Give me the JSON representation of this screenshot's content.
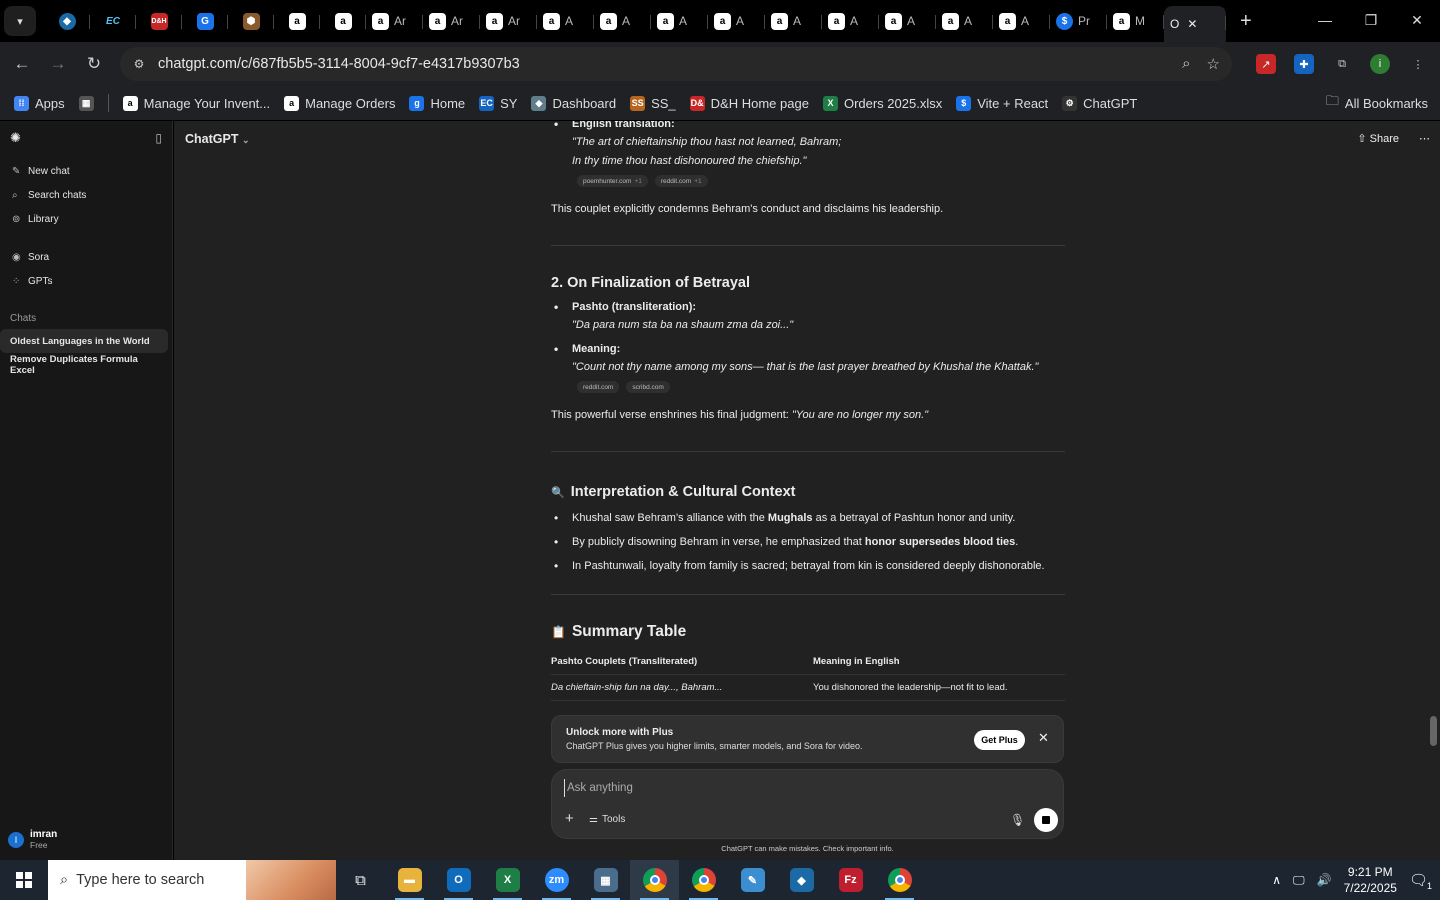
{
  "browser": {
    "tabs": [
      {
        "icon": "chevron-down-icon",
        "label": ""
      },
      {
        "icon": "ecstasy-icon",
        "label": ""
      },
      {
        "icon": "ec-icon",
        "label": "EC"
      },
      {
        "icon": "dh-icon",
        "label": "D&H"
      },
      {
        "icon": "g-icon",
        "label": ""
      },
      {
        "icon": "shield-icon",
        "label": ""
      },
      {
        "icon": "amazon-icon",
        "label": "a"
      },
      {
        "icon": "amazon-icon",
        "label": "a"
      }
    ],
    "wide_tabs": [
      {
        "icon": "a",
        "label": "Ar"
      },
      {
        "icon": "a",
        "label": "Ar"
      },
      {
        "icon": "a",
        "label": "Ar"
      },
      {
        "icon": "a",
        "label": "A"
      },
      {
        "icon": "a",
        "label": "A"
      },
      {
        "icon": "a",
        "label": "A"
      },
      {
        "icon": "a",
        "label": "A"
      },
      {
        "icon": "a",
        "label": "A"
      },
      {
        "icon": "a",
        "label": "A"
      },
      {
        "icon": "a",
        "label": "A"
      },
      {
        "icon": "a",
        "label": "A"
      },
      {
        "icon": "a",
        "label": "A"
      },
      {
        "icon": "$",
        "label": "Pr"
      },
      {
        "icon": "a",
        "label": "M"
      }
    ],
    "active_tab_label": "O",
    "url": "chatgpt.com/c/687fb5b5-3114-8004-9cf7-e4317b9307b3",
    "bookmarks": [
      {
        "icon": "apps",
        "label": "Apps",
        "color": "#4285f4"
      },
      {
        "icon": "grid",
        "label": "",
        "color": "#555"
      },
      {
        "icon": "a",
        "label": "Manage Your Invent...",
        "color": "#000"
      },
      {
        "icon": "a",
        "label": "Manage Orders",
        "color": "#000"
      },
      {
        "icon": "g",
        "label": "Home",
        "color": "#1a73e8"
      },
      {
        "icon": "EC",
        "label": "SY",
        "color": "#1565c0"
      },
      {
        "icon": "◆",
        "label": "Dashboard",
        "color": "#607d8b"
      },
      {
        "icon": "SS",
        "label": "SS_",
        "color": "#b5651d"
      },
      {
        "icon": "D&H",
        "label": "D&H Home page",
        "color": "#c62828"
      },
      {
        "icon": "X",
        "label": "Orders 2025.xlsx",
        "color": "#1e7e45"
      },
      {
        "icon": "$",
        "label": "Vite + React",
        "color": "#1a73e8"
      },
      {
        "icon": "⚙",
        "label": "ChatGPT",
        "color": "#333"
      }
    ],
    "all_bookmarks": "All Bookmarks"
  },
  "sidebar": {
    "items": [
      {
        "icon": "edit-icon",
        "label": "New chat"
      },
      {
        "icon": "search-icon",
        "label": "Search chats"
      },
      {
        "icon": "library-icon",
        "label": "Library"
      }
    ],
    "items2": [
      {
        "icon": "sora-icon",
        "label": "Sora"
      },
      {
        "icon": "gpts-icon",
        "label": "GPTs"
      }
    ],
    "chats_heading": "Chats",
    "chats": [
      "Oldest Languages in the World",
      "Remove Duplicates Formula Excel"
    ],
    "user": {
      "initial": "I",
      "name": "imran",
      "plan": "Free"
    }
  },
  "header": {
    "model": "ChatGPT",
    "share": "Share"
  },
  "content": {
    "english_translation_label": "English translation:",
    "translation_line1": "\"The art of chieftainship thou hast not learned, Bahram;",
    "translation_line2": "In thy time thou hast dishonoured the chiefship.\"",
    "chips1": [
      {
        "label": "poemhunter.com",
        "n": "+1"
      },
      {
        "label": "reddit.com",
        "n": "+1"
      }
    ],
    "para1": "This couplet explicitly condemns Behram's conduct and disclaims his leadership.",
    "h2_betrayal": "2. On Finalization of Betrayal",
    "pashto_label": "Pashto (transliteration):",
    "pashto_line": "\"Da para num sta ba na shaum zma da zoi...\"",
    "meaning_label": "Meaning:",
    "meaning_line": "\"Count not thy name among my sons— that is the last prayer breathed by Khushal the Khattak.\"",
    "chips2": [
      {
        "label": "reddit.com",
        "n": ""
      },
      {
        "label": "scribd.com",
        "n": ""
      }
    ],
    "para2_prefix": "This powerful verse enshrines his final judgment: ",
    "para2_quote": "\"You are no longer my son.\"",
    "h2_context_icon": "🔍",
    "h2_context": "Interpretation & Cultural Context",
    "context_b1_a": "Khushal saw Behram's alliance with the ",
    "context_b1_b": "Mughals",
    "context_b1_c": " as a betrayal of Pashtun honor and unity.",
    "context_b2_a": "By publicly disowning Behram in verse, he emphasized that ",
    "context_b2_b": "honor supersedes blood ties",
    "context_b2_c": ".",
    "context_b3": "In Pashtunwali, loyalty from family is sacred; betrayal from kin is considered deeply dishonorable.",
    "h2_summary_icon": "📋",
    "h2_summary": "Summary Table",
    "table_headers": [
      "Pashto Couplets (Transliterated)",
      "Meaning in English"
    ],
    "table_rows": [
      [
        "Da chieftain-ship fun na day..., Bahram...",
        "You dishonored the leadership—not fit to lead."
      ]
    ]
  },
  "banner": {
    "title": "Unlock more with Plus",
    "subtitle": "ChatGPT Plus gives you higher limits, smarter models, and Sora for video.",
    "button": "Get Plus"
  },
  "composer": {
    "placeholder": "Ask anything",
    "tools": "Tools"
  },
  "disclaimer": "ChatGPT can make mistakes. Check important info.",
  "taskbar": {
    "search_placeholder": "Type here to search",
    "time": "9:21 PM",
    "date": "7/22/2025",
    "notifications": "1"
  }
}
